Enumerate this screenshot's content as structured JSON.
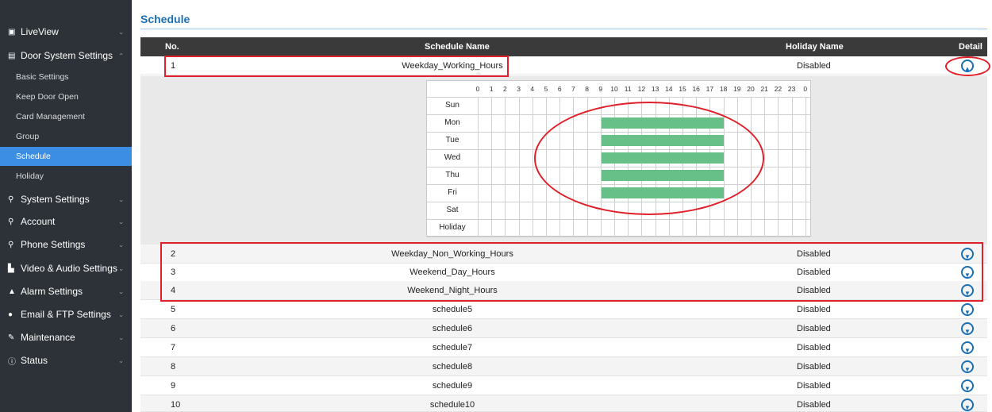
{
  "sidebar": {
    "items": [
      {
        "label": "LiveView",
        "icon": "liveview-icon"
      },
      {
        "label": "Door System Settings",
        "icon": "door-icon"
      },
      {
        "label": "System Settings",
        "icon": "wrench-icon"
      },
      {
        "label": "Account",
        "icon": "key-icon"
      },
      {
        "label": "Phone Settings",
        "icon": "phone-icon"
      },
      {
        "label": "Video & Audio Settings",
        "icon": "video-icon"
      },
      {
        "label": "Alarm Settings",
        "icon": "bell-icon"
      },
      {
        "label": "Email & FTP Settings",
        "icon": "cloud-icon"
      },
      {
        "label": "Maintenance",
        "icon": "wrench-icon"
      },
      {
        "label": "Status",
        "icon": "info-icon"
      }
    ],
    "door_sub": [
      "Basic Settings",
      "Keep Door Open",
      "Card Management",
      "Group",
      "Schedule",
      "Holiday"
    ],
    "active_sub": "Schedule"
  },
  "page": {
    "title": "Schedule"
  },
  "table": {
    "headers": {
      "no": "No.",
      "name": "Schedule Name",
      "holiday": "Holiday Name",
      "detail": "Detail"
    },
    "rows": [
      {
        "no": "1",
        "name": "Weekday_Working_Hours",
        "holiday": "Disabled"
      },
      {
        "no": "2",
        "name": "Weekday_Non_Working_Hours",
        "holiday": "Disabled"
      },
      {
        "no": "3",
        "name": "Weekend_Day_Hours",
        "holiday": "Disabled"
      },
      {
        "no": "4",
        "name": "Weekend_Night_Hours",
        "holiday": "Disabled"
      },
      {
        "no": "5",
        "name": "schedule5",
        "holiday": "Disabled"
      },
      {
        "no": "6",
        "name": "schedule6",
        "holiday": "Disabled"
      },
      {
        "no": "7",
        "name": "schedule7",
        "holiday": "Disabled"
      },
      {
        "no": "8",
        "name": "schedule8",
        "holiday": "Disabled"
      },
      {
        "no": "9",
        "name": "schedule9",
        "holiday": "Disabled"
      },
      {
        "no": "10",
        "name": "schedule10",
        "holiday": "Disabled"
      }
    ]
  },
  "schedule_detail": {
    "hours": [
      "0",
      "1",
      "2",
      "3",
      "4",
      "5",
      "6",
      "7",
      "8",
      "9",
      "10",
      "11",
      "12",
      "13",
      "14",
      "15",
      "16",
      "17",
      "18",
      "19",
      "20",
      "21",
      "22",
      "23",
      "0"
    ],
    "days": [
      "Sun",
      "Mon",
      "Tue",
      "Wed",
      "Thu",
      "Fri",
      "Sat",
      "Holiday"
    ],
    "active_ranges": [
      {
        "day": "Mon",
        "start": 9,
        "end": 18
      },
      {
        "day": "Tue",
        "start": 9,
        "end": 18
      },
      {
        "day": "Wed",
        "start": 9,
        "end": 18
      },
      {
        "day": "Thu",
        "start": 9,
        "end": 18
      },
      {
        "day": "Fri",
        "start": 9,
        "end": 18
      }
    ],
    "bar_color": "#66c087"
  },
  "colors": {
    "accent": "#1a6fb5",
    "sidebar_bg": "#2d3238",
    "active_bg": "#3b8ee3",
    "annotation": "#e0202a"
  }
}
